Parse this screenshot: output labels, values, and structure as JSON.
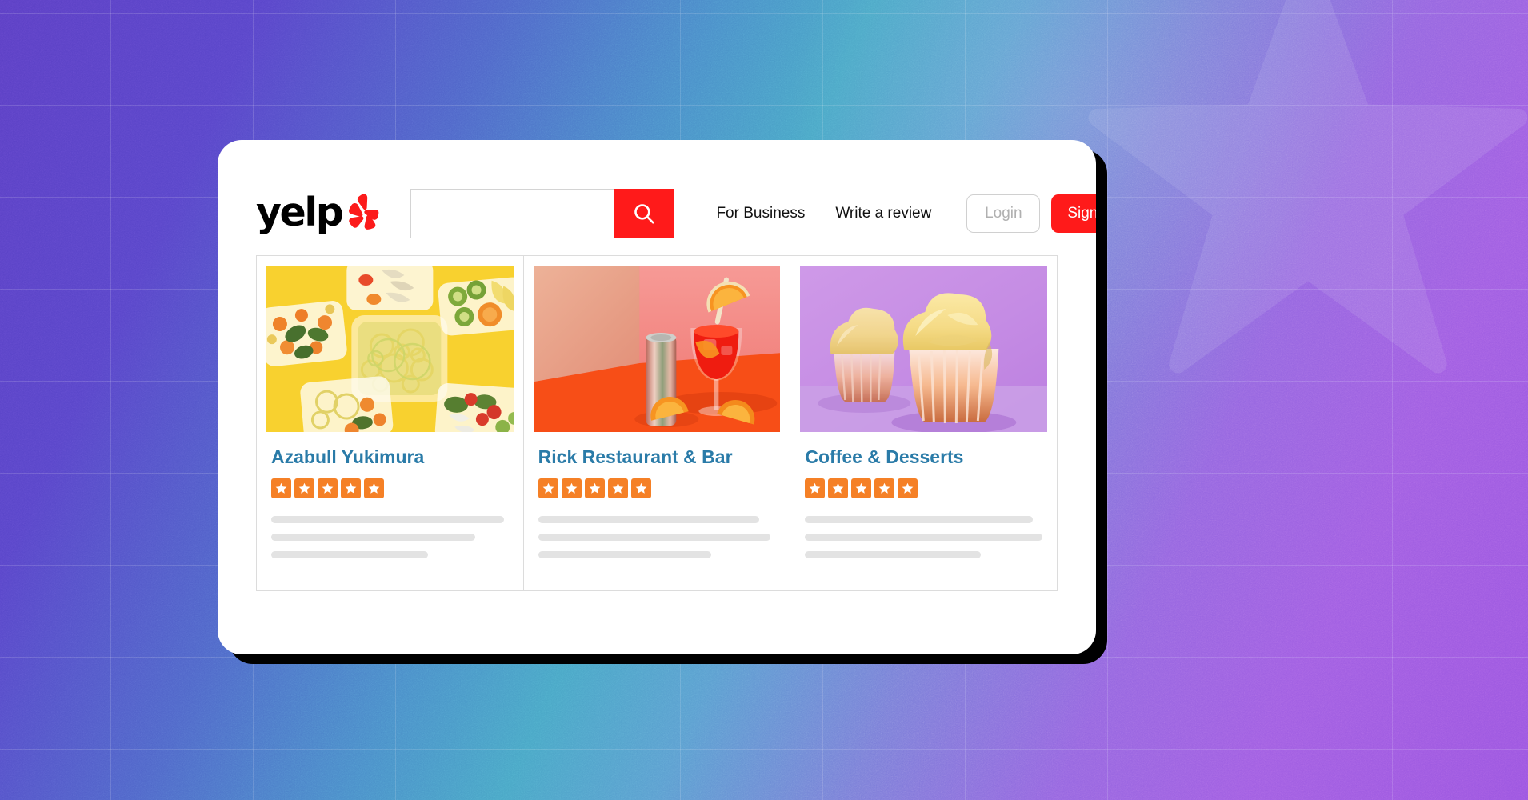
{
  "background": {
    "gradient_from": "#5b3fc4",
    "gradient_mid": "#49a6c6",
    "gradient_to": "#9b55e0",
    "grid_line_color": "rgba(255,255,255,0.13)",
    "watermark_icon": "star-watermark"
  },
  "browser": {
    "shadow_color": "#000000",
    "surface_color": "#ffffff"
  },
  "header": {
    "logo": {
      "wordmark": "yelp",
      "burst_icon": "yelp-burst-icon",
      "wordmark_color": "#000000",
      "burst_color": "#fc1b1b"
    },
    "search": {
      "value": "",
      "placeholder": "",
      "button_icon": "search-icon",
      "button_color": "#ff1a1a"
    },
    "nav_links": [
      {
        "label": "For Business"
      },
      {
        "label": "Write a review"
      }
    ],
    "auth": {
      "login_label": "Login",
      "login_text_color": "#b0b0b0",
      "signup_label": "Sign Up",
      "signup_color": "#ff1a1a"
    }
  },
  "results": {
    "border_color": "#dcdcdc",
    "title_color": "#2a7ba8",
    "star_color": "#f58026",
    "skeleton_color": "#e3e3e3",
    "cards": [
      {
        "title": "Azabull Yukimura",
        "rating": 5,
        "photo": "meal-prep-containers-photo",
        "photo_bg": "#f8d12f",
        "skeleton_widths": [
          "98%",
          "86%",
          "66%"
        ]
      },
      {
        "title": "Rick Restaurant & Bar",
        "rating": 5,
        "photo": "cocktail-orange-photo",
        "photo_bg": "#f2796a",
        "skeleton_widths": [
          "93%",
          "98%",
          "73%"
        ]
      },
      {
        "title": "Coffee & Desserts",
        "rating": 5,
        "photo": "cupcakes-photo",
        "photo_bg": "#c07fe0",
        "skeleton_widths": [
          "96%",
          "100%",
          "74%"
        ]
      }
    ]
  }
}
